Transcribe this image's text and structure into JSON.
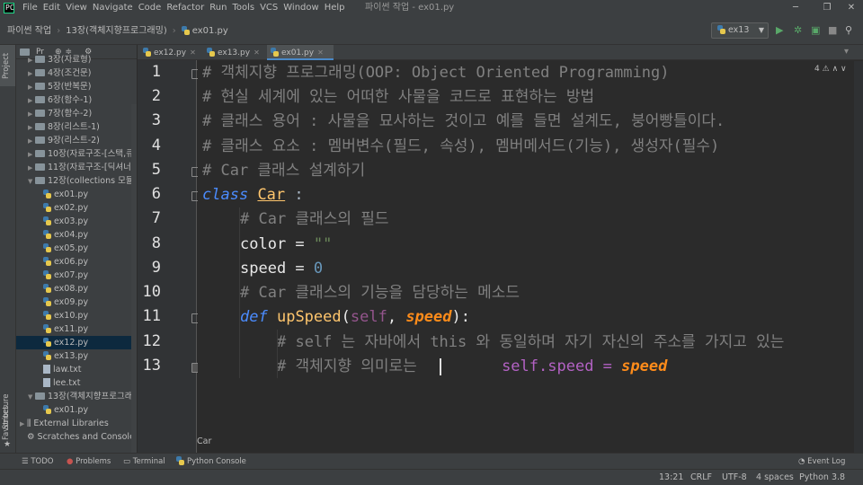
{
  "window": {
    "title": "파이썬 작업 - ex01.py",
    "app_icon_text": "PC"
  },
  "menu": [
    "File",
    "Edit",
    "View",
    "Navigate",
    "Code",
    "Refactor",
    "Run",
    "Tools",
    "VCS",
    "Window",
    "Help"
  ],
  "navbar": {
    "breadcrumb": [
      "파이썬 작업",
      "13장(객체지향프로그래밍)",
      "ex01.py"
    ],
    "run_config": "ex13"
  },
  "left_strip": {
    "project_label": "Project",
    "structure_label": "Structure",
    "favorites_label": "Favorites"
  },
  "project_panel": {
    "header_label": "Pr",
    "items": [
      {
        "label": "3장(자료형)",
        "type": "folder",
        "indent": 1
      },
      {
        "label": "4장(조건문)",
        "type": "folder",
        "indent": 1
      },
      {
        "label": "5장(반복문)",
        "type": "folder",
        "indent": 1
      },
      {
        "label": "6장(함수-1)",
        "type": "folder",
        "indent": 1
      },
      {
        "label": "7장(함수-2)",
        "type": "folder",
        "indent": 1
      },
      {
        "label": "8장(리스트-1)",
        "type": "folder",
        "indent": 1
      },
      {
        "label": "9장(리스트-2)",
        "type": "folder",
        "indent": 1
      },
      {
        "label": "10장(자료구조-[스택,큐,",
        "type": "folder",
        "indent": 1
      },
      {
        "label": "11장(자료구조-[딕셔너리",
        "type": "folder",
        "indent": 1
      },
      {
        "label": "12장(collections 모듈)",
        "type": "folder",
        "indent": 1,
        "expanded": true
      },
      {
        "label": "ex01.py",
        "type": "py",
        "indent": 2
      },
      {
        "label": "ex02.py",
        "type": "py",
        "indent": 2
      },
      {
        "label": "ex03.py",
        "type": "py",
        "indent": 2
      },
      {
        "label": "ex04.py",
        "type": "py",
        "indent": 2
      },
      {
        "label": "ex05.py",
        "type": "py",
        "indent": 2
      },
      {
        "label": "ex06.py",
        "type": "py",
        "indent": 2
      },
      {
        "label": "ex07.py",
        "type": "py",
        "indent": 2
      },
      {
        "label": "ex08.py",
        "type": "py",
        "indent": 2
      },
      {
        "label": "ex09.py",
        "type": "py",
        "indent": 2
      },
      {
        "label": "ex10.py",
        "type": "py",
        "indent": 2
      },
      {
        "label": "ex11.py",
        "type": "py",
        "indent": 2
      },
      {
        "label": "ex12.py",
        "type": "py",
        "indent": 2,
        "selected": true
      },
      {
        "label": "ex13.py",
        "type": "py",
        "indent": 2
      },
      {
        "label": "law.txt",
        "type": "txt",
        "indent": 2
      },
      {
        "label": "lee.txt",
        "type": "txt",
        "indent": 2
      },
      {
        "label": "13장(객체지향프로그래밍",
        "type": "folder",
        "indent": 1,
        "expanded": true
      },
      {
        "label": "ex01.py",
        "type": "py",
        "indent": 2
      },
      {
        "label": "External Libraries",
        "type": "lib",
        "indent": 0
      },
      {
        "label": "Scratches and Consoles",
        "type": "scratch",
        "indent": 0
      }
    ]
  },
  "tabs": [
    {
      "label": "ex12.py",
      "active": false
    },
    {
      "label": "ex13.py",
      "active": false
    },
    {
      "label": "ex01.py",
      "active": true
    }
  ],
  "editor": {
    "inspection_badge": "4",
    "line_numbers": [
      "1",
      "2",
      "3",
      "4",
      "5",
      "6",
      "7",
      "8",
      "9",
      "10",
      "11",
      "12",
      "13"
    ],
    "lines": {
      "l1": "# 객체지향 프로그래밍(OOP: Object Oriented Programming)",
      "l2": "# 현실 세계에 있는 어떠한 사물을 코드로 표현하는 방법",
      "l3": "# 클래스 용어 : 사물을 묘사하는 것이고 예를 들면 설계도, 붕어빵틀이다.",
      "l4": "# 클래스 요소 : 멤버변수(필드, 속성), 멤버메서드(기능), 생성자(필수)",
      "l5": "# Car 클래스 설계하기",
      "l6_kw": "class",
      "l6_name": "Car",
      "l6_colon": " :",
      "l7": "# Car 클래스의 필드",
      "l8_name": "color = ",
      "l8_val": "\"\"",
      "l9_name": "speed = ",
      "l9_val": "0",
      "l10": "# Car 클래스의 기능을 담당하는 메소드",
      "l11_kw": "def",
      "l11_fn": "upSpeed",
      "l11_open": "(",
      "l11_self": "self",
      "l11_comma": ", ",
      "l11_param": "speed",
      "l11_close": "):",
      "l12": "# self 는 자바에서 this 와 동일하며 자기 자신의 주소를 가지고 있는",
      "l13_comment": "# 객체지향 의미로는 ",
      "l13_self": "self",
      "l13_attr": ".speed = ",
      "l13_param": "speed"
    },
    "bottom_breadcrumb": "Car"
  },
  "tool_windows": {
    "todo": "TODO",
    "problems": "Problems",
    "terminal": "Terminal",
    "python_console": "Python Console",
    "event_log": "Event Log"
  },
  "status": {
    "position": "13:21",
    "line_sep": "CRLF",
    "encoding": "UTF-8",
    "indent": "4 spaces",
    "interpreter": "Python 3.8"
  },
  "colors": {
    "comment": "#808080",
    "keyword": "#4b8cff",
    "class_name": "#ffc66d",
    "string": "#6a8759",
    "number": "#6897bb",
    "self": "#94558d",
    "param": "#ff8c1a"
  }
}
